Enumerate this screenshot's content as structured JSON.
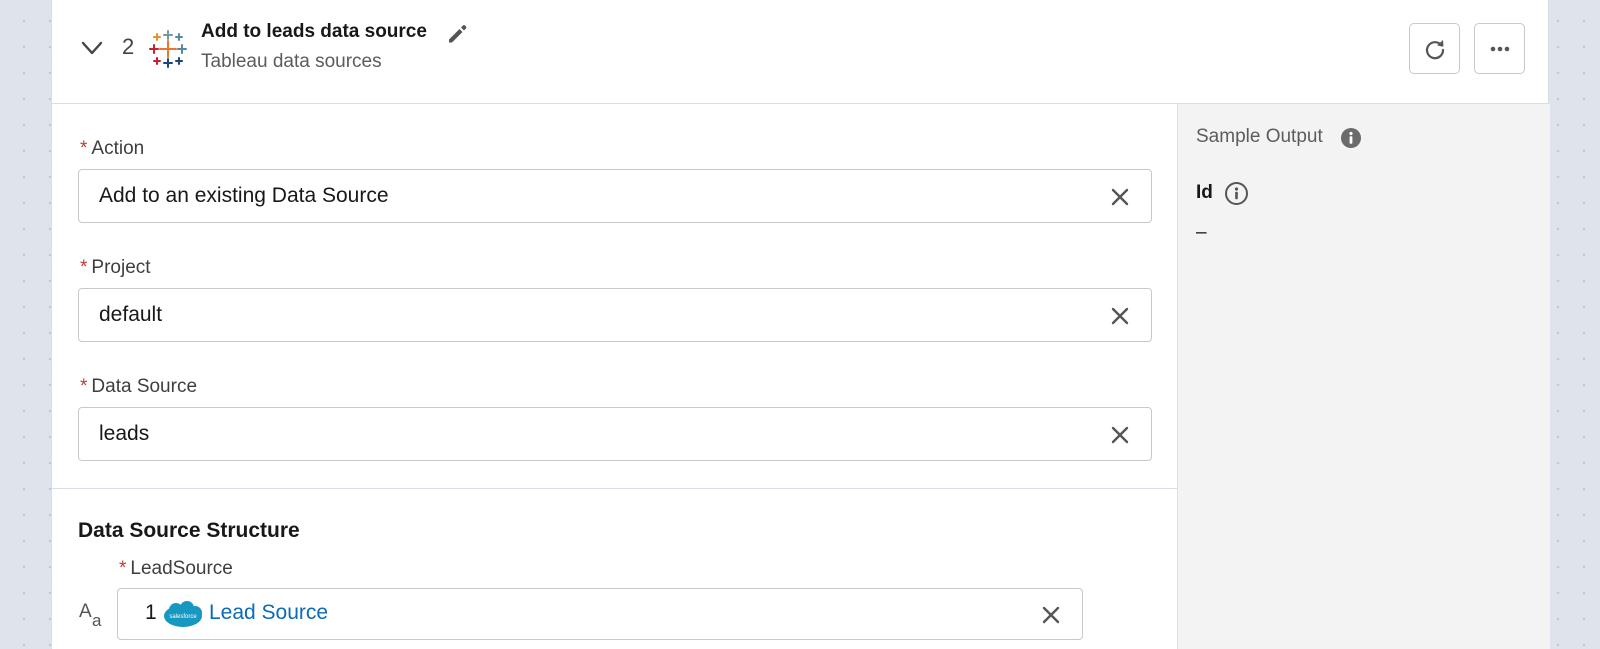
{
  "step": {
    "number": "2",
    "title": "Add to leads data source",
    "connector": "Tableau data sources"
  },
  "icons": {
    "collapse": "chevron-down-icon",
    "app": "tableau-logo",
    "edit": "pencil-icon",
    "refresh": "refresh-icon",
    "more": "ellipsis-icon",
    "clear": "close-icon",
    "info": "info-icon",
    "text_type": "text-type-icon",
    "source": "salesforce-logo"
  },
  "colors": {
    "required": "#c23934",
    "link": "#0b6bb8",
    "salesforce": "#1798c1"
  },
  "form": {
    "required_mark": "*",
    "fields": [
      {
        "label": "Action",
        "value": "Add to an existing Data Source"
      },
      {
        "label": "Project",
        "value": "default"
      },
      {
        "label": "Data Source",
        "value": "leads"
      }
    ]
  },
  "structure": {
    "title": "Data Source Structure",
    "field_label": "LeadSource",
    "mapping_step": "1",
    "mapping_text": "Lead Source",
    "logo_text": "salesforce"
  },
  "sample": {
    "title": "Sample Output",
    "field": "Id",
    "value": "–"
  }
}
